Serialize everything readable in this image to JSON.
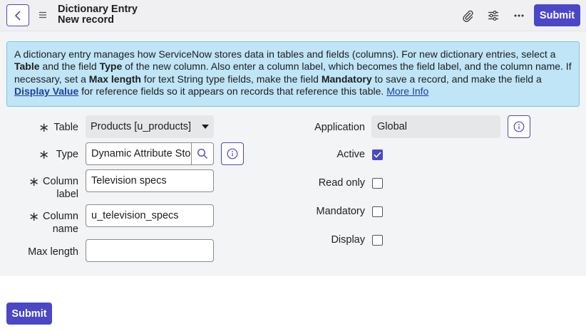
{
  "header": {
    "title": "Dictionary Entry",
    "subtitle": "New record",
    "submit_label": "Submit",
    "icons": [
      "back-icon",
      "menu-icon",
      "paperclip-icon",
      "sliders-icon",
      "more-icon"
    ]
  },
  "info": {
    "p1": "A dictionary entry manages how ServiceNow stores data in tables and fields (columns). For new dictionary entries, select a ",
    "b1": "Table",
    "p2": " and the field ",
    "b2": "Type",
    "p3": " of the new column. Also enter a column label, which becomes the field label, and the column name. If necessary, set a ",
    "b3": "Max length",
    "p4": " for text String type fields, make the field ",
    "b4": "Mandatory",
    "p5": " to save a record, and make the field a ",
    "link1": "Display Value",
    "p6": " for reference fields so it appears on records that reference this table. ",
    "link2": "More Info"
  },
  "form": {
    "required_mark": "∗",
    "table_label": "Table",
    "table_value": "Products [u_products]",
    "type_label": "Type",
    "type_value": "Dynamic Attribute Store",
    "column_label_label_1": "Column",
    "column_label_label_2": "label",
    "column_label_value": "Television specs",
    "column_name_label_1": "Column",
    "column_name_label_2": "name",
    "column_name_value": "u_television_specs",
    "max_length_label": "Max length",
    "max_length_value": "",
    "application_label": "Application",
    "application_value": "Global",
    "active_label": "Active",
    "active_checked": true,
    "read_only_label": "Read only",
    "read_only_checked": false,
    "mandatory_label": "Mandatory",
    "mandatory_checked": false,
    "display_label": "Display",
    "display_checked": false
  },
  "footer": {
    "submit_label": "Submit"
  },
  "colors": {
    "accent": "#4b47c6",
    "info_bg": "#bfe5f7",
    "info_border": "#83c3e2"
  }
}
